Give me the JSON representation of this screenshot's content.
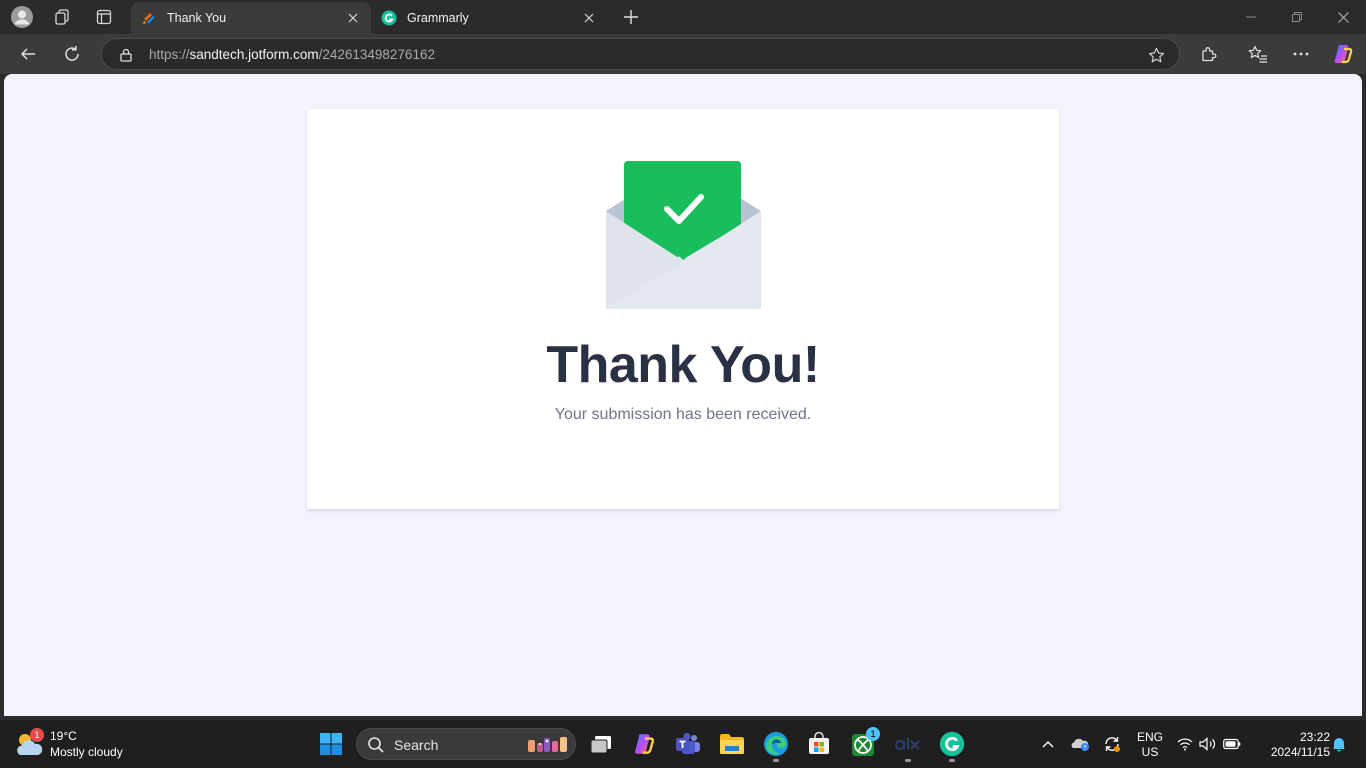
{
  "browser": {
    "tabs": [
      {
        "title": "Thank You",
        "active": true,
        "favicon": "jotform-icon"
      },
      {
        "title": "Grammarly",
        "active": false,
        "favicon": "grammarly-icon"
      }
    ],
    "address": {
      "scheme": "https://",
      "host": "sandtech.jotform.com",
      "path": "/242613498276162"
    }
  },
  "page": {
    "title": "Thank You!",
    "subtitle": "Your submission has been received.",
    "colors": {
      "background": "#f3f3fe",
      "card": "#ffffff",
      "check_green": "#19bd5c",
      "title": "#2a3145"
    }
  },
  "taskbar": {
    "weather": {
      "temperature": "19°C",
      "condition": "Mostly cloudy",
      "badge": "1"
    },
    "search_label": "Search",
    "xbox_badge": "1",
    "language": {
      "line1": "ENG",
      "line2": "US"
    },
    "clock": {
      "time": "23:22",
      "date": "2024/11/15"
    }
  }
}
